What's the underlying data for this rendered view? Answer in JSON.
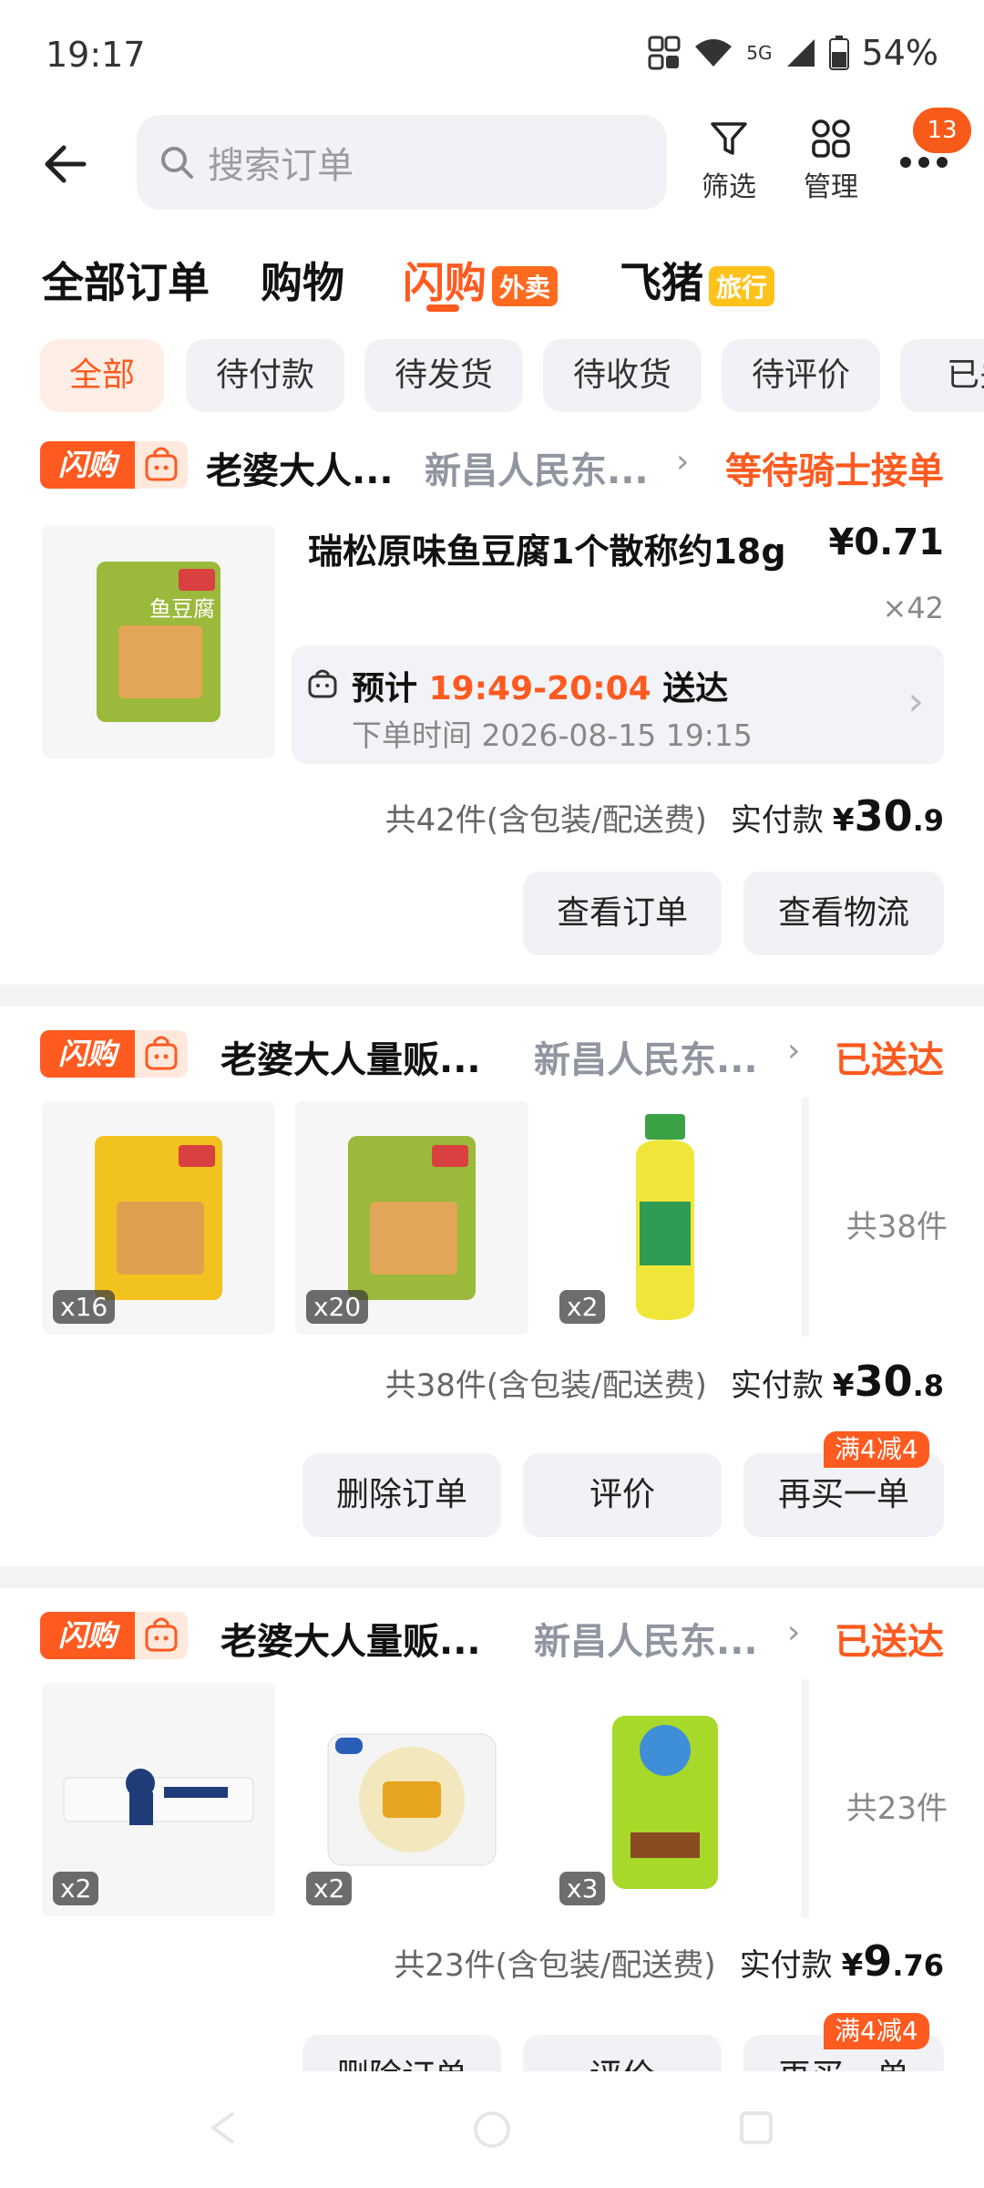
{
  "status_bar": {
    "time": "19:17",
    "network": "5G",
    "battery": "54%"
  },
  "header": {
    "search_placeholder": "搜索订单",
    "filter_label": "筛选",
    "manage_label": "管理",
    "more_badge": "13"
  },
  "tabs": [
    {
      "label": "全部订单"
    },
    {
      "label": "购物"
    },
    {
      "label": "闪购",
      "tag": "外卖"
    },
    {
      "label": "飞猪",
      "tag": "旅行"
    }
  ],
  "filters": [
    "全部",
    "待付款",
    "待发货",
    "待收货",
    "待评价",
    "已关"
  ],
  "orders": [
    {
      "brand": "闪购",
      "shop": "老婆大人...",
      "location": "新昌人民东...",
      "status": "等待骑士接单",
      "product_name": "瑞松原味鱼豆腐1个散称约18g",
      "price": "¥0.71",
      "qty": "×42",
      "eta_prefix": "预计",
      "eta_time": "19:49-20:04",
      "eta_suffix": "送达",
      "order_time": "下单时间 2026-08-15 19:15",
      "summary": "共42件(含包装/配送费)",
      "paid_label": "实付款",
      "paid_yen": "¥",
      "paid_int": "30",
      "paid_dec": ".9",
      "buttons": [
        "查看订单",
        "查看物流"
      ]
    },
    {
      "brand": "闪购",
      "shop": "老婆大人量贩...",
      "location": "新昌人民东...",
      "status": "已送达",
      "items": [
        {
          "qty": "x16"
        },
        {
          "qty": "x20"
        },
        {
          "qty": "x2"
        }
      ],
      "count": "共38件",
      "summary": "共38件(含包装/配送费)",
      "paid_label": "实付款",
      "paid_yen": "¥",
      "paid_int": "30",
      "paid_dec": ".8",
      "buttons": [
        "删除订单",
        "评价",
        "再买一单"
      ],
      "promo": "满4减4"
    },
    {
      "brand": "闪购",
      "shop": "老婆大人量贩...",
      "location": "新昌人民东...",
      "status": "已送达",
      "items": [
        {
          "qty": "x2"
        },
        {
          "qty": "x2"
        },
        {
          "qty": "x3"
        }
      ],
      "count": "共23件",
      "summary": "共23件(含包装/配送费)",
      "paid_label": "实付款",
      "paid_yen": "¥",
      "paid_int": "9",
      "paid_dec": ".76",
      "buttons": [
        "删除订单",
        "评价",
        "再买一单"
      ],
      "promo": "满4减4"
    }
  ],
  "colors": {
    "accent": "#ff5a1f",
    "chip_bg": "#f1f2f5",
    "yellow_tag": "#ffc21c"
  }
}
